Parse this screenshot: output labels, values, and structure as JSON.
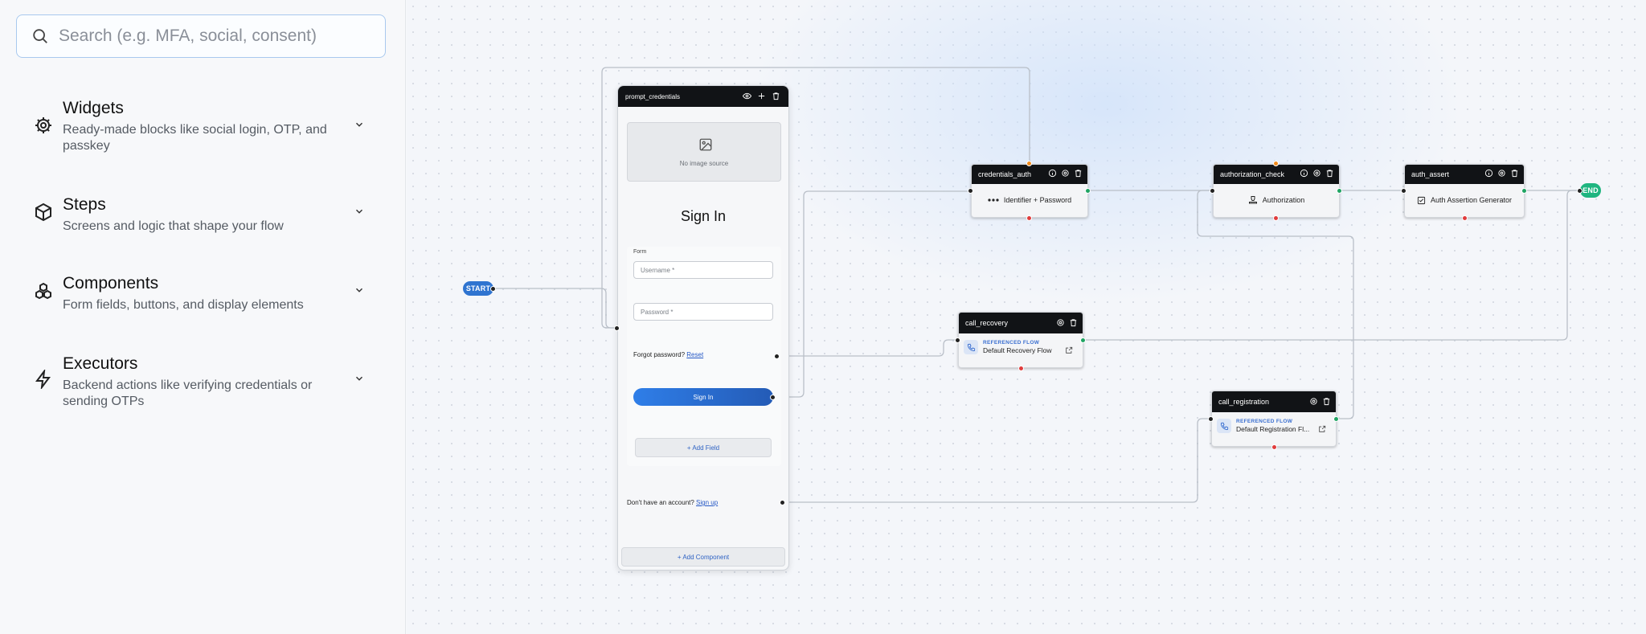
{
  "search": {
    "placeholder": "Search (e.g. MFA, social, consent)"
  },
  "sidebar": {
    "categories": [
      {
        "title": "Widgets",
        "desc": "Ready-made blocks like social login, OTP, and passkey",
        "icon": "widgets-gear-icon"
      },
      {
        "title": "Steps",
        "desc": "Screens and logic that shape your flow",
        "icon": "cube-icon"
      },
      {
        "title": "Components",
        "desc": "Form fields, buttons, and display elements",
        "icon": "components-icon"
      },
      {
        "title": "Executors",
        "desc": "Backend actions like verifying credentials or sending OTPs",
        "icon": "lightning-icon"
      }
    ]
  },
  "canvas": {
    "start_label": "START",
    "end_label": "END",
    "prompt": {
      "title": "prompt_credentials",
      "image_caption": "No image source",
      "heading": "Sign In",
      "form_label": "Form",
      "username_placeholder": "Username *",
      "password_placeholder": "Password *",
      "forgot_text": "Forgot password?",
      "reset_link": "Reset",
      "signin_button": "Sign In",
      "add_field": "+ Add Field",
      "signup_text": "Don't have an account?",
      "signup_link": "Sign up",
      "add_component": "+ Add Component"
    },
    "credentials_auth": {
      "title": "credentials_auth",
      "body": "Identifier + Password"
    },
    "authorization_check": {
      "title": "authorization_check",
      "body": "Authorization"
    },
    "auth_assert": {
      "title": "auth_assert",
      "body": "Auth Assertion Generator"
    },
    "call_recovery": {
      "title": "call_recovery",
      "ref_label": "REFERENCED FLOW",
      "ref_name": "Default Recovery Flow"
    },
    "call_registration": {
      "title": "call_registration",
      "ref_label": "REFERENCED FLOW",
      "ref_name": "Default Registration Fl..."
    }
  },
  "colors": {
    "accent": "#2f74d0",
    "end": "#1fb580",
    "error_handle": "#e03c3c",
    "success_handle": "#1fa463"
  }
}
